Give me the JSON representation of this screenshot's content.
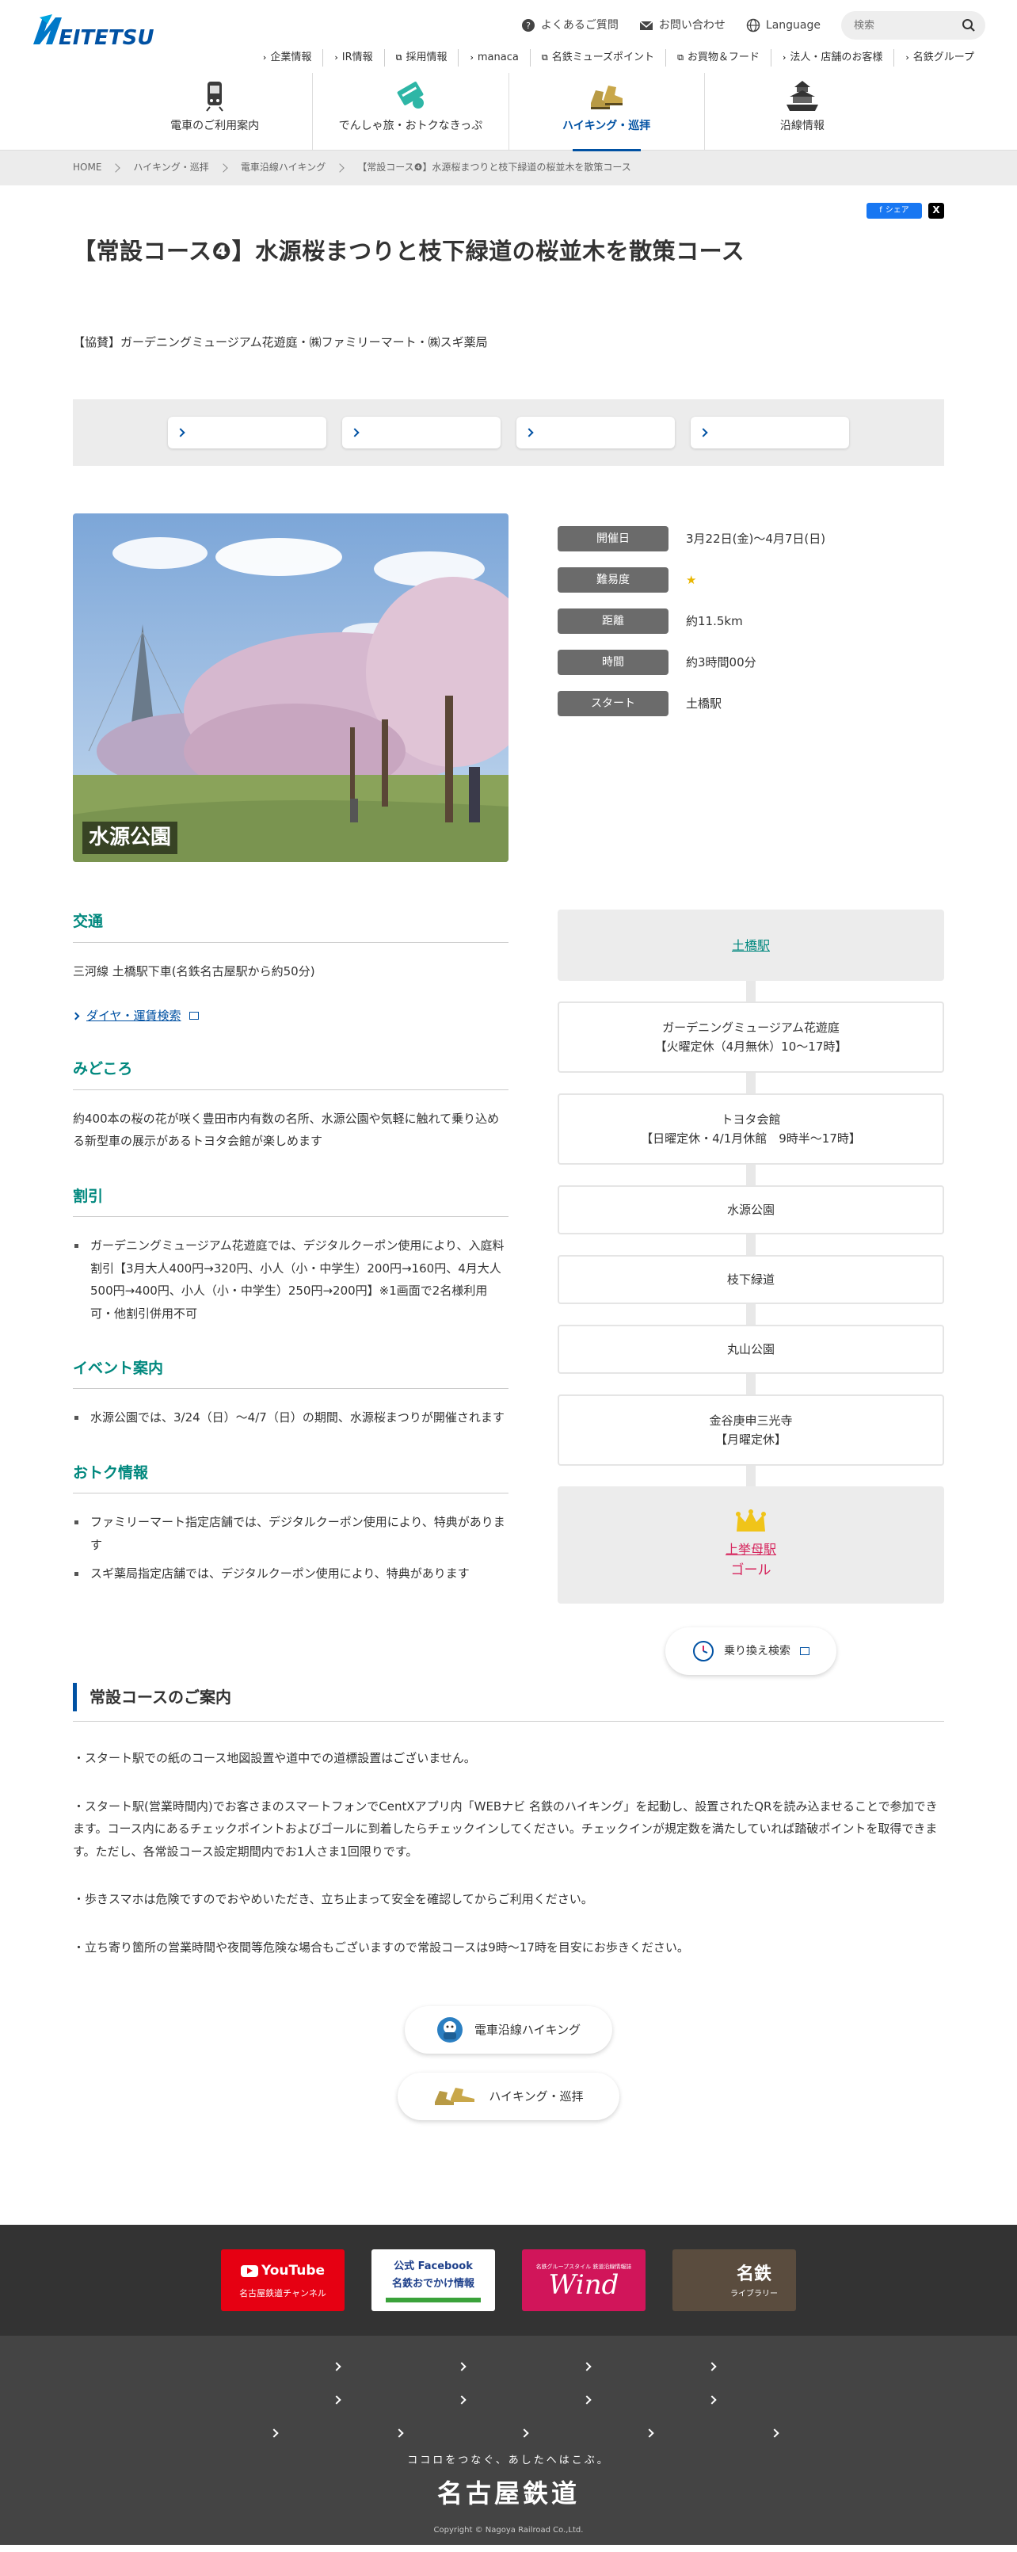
{
  "header": {
    "utility": {
      "faq": "よくあるご質問",
      "contact": "お問い合わせ",
      "language": "Language",
      "search_placeholder": "検索"
    },
    "subnav": [
      "企業情報",
      "IR情報",
      "採用情報",
      "manaca",
      "名鉄ミューズポイント",
      "お買物＆フード",
      "法人・店舗のお客様",
      "名鉄グループ"
    ],
    "mainnav": [
      "電車のご利用案内",
      "でんしゃ旅・おトクなきっぷ",
      "ハイキング・巡拝",
      "沿線情報"
    ]
  },
  "breadcrumb": [
    "HOME",
    "ハイキング・巡拝",
    "電車沿線ハイキング",
    "【常設コース❹】水源桜まつりと枝下緑道の桜並木を散策コース"
  ],
  "share": {
    "facebook": "シェア",
    "x": "X"
  },
  "title": "【常設コース❹】水源桜まつりと枝下緑道の桜並木を散策コース",
  "sponsor": "【協賛】ガーデニングミュージアム花遊庭・㈱ファミリーマート・㈱スギ薬局",
  "photo_caption": "水源公園",
  "info": [
    {
      "label": "開催日",
      "value": "3月22日(金)～4月7日(日)"
    },
    {
      "label": "難易度",
      "value": "★"
    },
    {
      "label": "距離",
      "value": "約11.5km"
    },
    {
      "label": "時間",
      "value": "約3時間00分"
    },
    {
      "label": "スタート",
      "value": "土橋駅"
    }
  ],
  "sections": {
    "access": {
      "heading": "交通",
      "text": "三河線 土橋駅下車(名鉄名古屋駅から約50分)",
      "link": "ダイヤ・運賃検索"
    },
    "highlights": {
      "heading": "みどころ",
      "text": "約400本の桜の花が咲く豊田市内有数の名所、水源公園や気軽に触れて乗り込める新型車の展示があるトヨタ会館が楽しめます"
    },
    "discount": {
      "heading": "割引",
      "items": [
        "ガーデニングミュージアム花遊庭では、デジタルクーポン使用により、入庭料割引【3月大人400円→320円、小人（小・中学生）200円→160円、4月大人500円→400円、小人（小・中学生）250円→200円】※1画面で2名様利用可・他割引併用不可"
      ]
    },
    "event": {
      "heading": "イベント案内",
      "items": [
        "水源公園では、3/24（日）～4/7（日）の期間、水源桜まつりが開催されます"
      ]
    },
    "deals": {
      "heading": "おトク情報",
      "items": [
        "ファミリーマート指定店舗では、デジタルクーポン使用により、特典があります",
        "スギ薬局指定店舗では、デジタルクーポン使用により、特典があります"
      ]
    }
  },
  "route": {
    "start": "土橋駅",
    "stops": [
      {
        "name": "ガーデニングミュージアム花遊庭",
        "note": "【火曜定休（4月無休）10～17時】"
      },
      {
        "name": "トヨタ会館",
        "note": "【日曜定休・4/1月休館　9時半～17時】"
      },
      {
        "name": "水源公園",
        "note": ""
      },
      {
        "name": "枝下緑道",
        "note": ""
      },
      {
        "name": "丸山公園",
        "note": ""
      },
      {
        "name": "金谷庚申三光寺",
        "note": "【月曜定休】"
      }
    ],
    "goal_station": "上挙母駅",
    "goal_label": "ゴール",
    "transfer_button": "乗り換え検索"
  },
  "guide": {
    "heading": "常設コースのご案内",
    "paragraphs": [
      "・スタート駅での紙のコース地図設置や道中での道標設置はございません。",
      "・スタート駅(営業時間内)でお客さまのスマートフォンでCentXアプリ内「WEBナビ 名鉄のハイキング」を起動し、設置されたQRを読み込ませることで参加できます。コース内にあるチェックポイントおよびゴールに到着したらチェックインしてください。チェックインが規定数を満たしていれば踏破ポイントを取得できます。ただし、各常設コース設定期間内でお1人さま1回限りです。",
      "・歩きスマホは危険ですのでおやめいただき、立ち止まって安全を確認してからご利用ください。",
      "・立ち寄り箇所の営業時間や夜間等危険な場合もございますので常設コースは9時～17時を目安にお歩きください。"
    ]
  },
  "bottom_buttons": [
    "電車沿線ハイキング",
    "ハイキング・巡拝"
  ],
  "footer": {
    "banners": {
      "youtube_logo": "YouTube",
      "youtube_sub": "名古屋鉄道チャンネル",
      "facebook_logo": "公式 Facebook",
      "facebook_sub": "名鉄おでかけ情報",
      "wind_top": "名鉄グループスタイル 鉄道沿線情報誌",
      "wind_logo": "Wind",
      "library_logo": "名鉄",
      "library_sub": "ライブラリー"
    },
    "tagline": "ココロをつなぐ、あしたへはこぶ。",
    "brand": "名古屋鉄道",
    "copyright": "Copyright © Nagoya Railroad Co.,Ltd."
  },
  "colors": {
    "brand_blue": "#0051a3",
    "section_teal": "#00887e",
    "goal_pink": "#d6245c",
    "label_gray": "#6b6b6b"
  }
}
